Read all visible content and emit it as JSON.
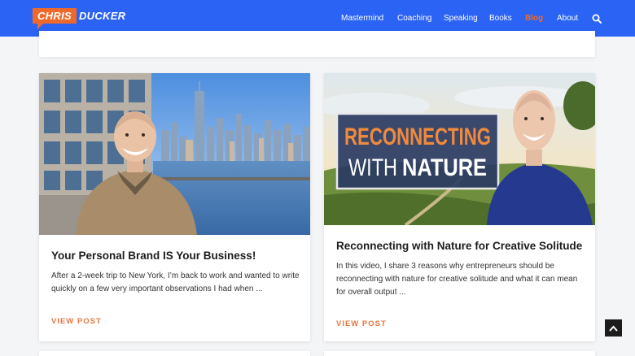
{
  "header": {
    "logo": {
      "tag": "CHRIS",
      "text": "DUCKER"
    },
    "nav": [
      {
        "label": "Mastermind",
        "active": false
      },
      {
        "label": "Coaching",
        "active": false
      },
      {
        "label": "Speaking",
        "active": false
      },
      {
        "label": "Books",
        "active": false
      },
      {
        "label": "Blog",
        "active": true
      },
      {
        "label": "About",
        "active": false
      }
    ],
    "search_icon": "search-icon"
  },
  "posts": [
    {
      "title": "Your Personal Brand IS Your Business!",
      "excerpt": "After a 2-week trip to New York, I’m back to work and wanted to write quickly on a few very important observations I had when ...",
      "cta": "VIEW POST",
      "image": "man-in-front-of-new-york-skyline"
    },
    {
      "title": "Reconnecting with Nature for Creative Solitude",
      "excerpt": "In this video, I share 3 reasons why entrepreneurs should be reconnecting with nature for creative solitude and what it can mean for overall output ...",
      "cta": "VIEW POST",
      "image": "reconnecting-with-nature-thumbnail",
      "image_text": {
        "line1": "RECONNECTING",
        "line2a": "WITH",
        "line2b": "NATURE"
      }
    }
  ],
  "back_to_top_icon": "chevron-up-icon",
  "colors": {
    "header": "#2b63f4",
    "accent": "#ef6a2a",
    "cta": "#e8763f"
  }
}
